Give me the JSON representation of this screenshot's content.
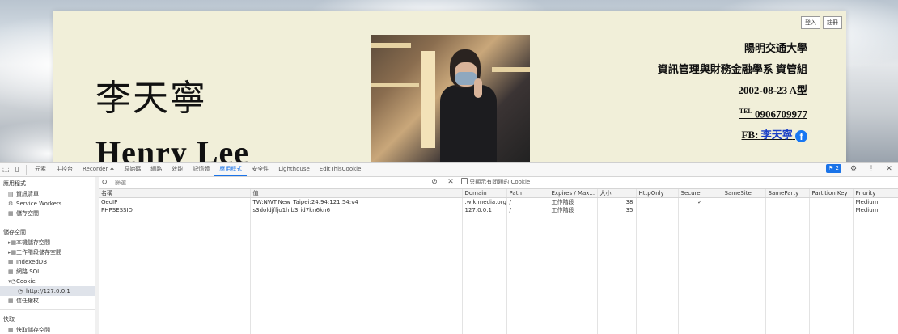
{
  "webpage": {
    "auth": {
      "login": "登入",
      "register": "註冊"
    },
    "name_cn": "李天寧",
    "name_en": "Henry Lee",
    "info": {
      "school": "陽明交通大學",
      "department": "資訊管理與財務金融學系 資管組",
      "birth": "2002-08-23 A型",
      "tel_prefix": "TEL",
      "tel": "0906709977",
      "fb_prefix": "FB:",
      "fb_name": "李天寧",
      "fb_icon": "f"
    }
  },
  "devtools": {
    "tabs": [
      "元素",
      "主控台",
      "Recorder ⏶",
      "原始碼",
      "網路",
      "效能",
      "記憶體",
      "應用程式",
      "安全性",
      "Lighthouse",
      "EditThisCookie"
    ],
    "active_tab": "應用程式",
    "issues_count": "2",
    "sidebar": {
      "app_section": "應用程式",
      "app_items": [
        "資訊清單",
        "Service Workers",
        "儲存空間"
      ],
      "storage_section": "儲存空間",
      "storage_items": [
        "本機儲存空間",
        "工作階段儲存空間",
        "IndexedDB",
        "網路 SQL",
        "Cookie"
      ],
      "cookie_origin": "http://127.0.0.1",
      "trust_tokens": "信任權杖",
      "cache_section": "快取",
      "cache_item": "快取儲存空間"
    },
    "filter": {
      "placeholder": "篩選",
      "only_issues_label": "只顯示有問題的 Cookie"
    },
    "table": {
      "headers": [
        "名稱",
        "值",
        "Domain",
        "Path",
        "Expires / Max...",
        "大小",
        "HttpOnly",
        "Secure",
        "SameSite",
        "SameParty",
        "Partition Key",
        "Priority"
      ],
      "rows": [
        [
          "GeoIP",
          "TW:NWT:New_Taipei:24.94:121.54:v4",
          ".wikimedia.org",
          "/",
          "工作階段",
          "38",
          "",
          "✓",
          "",
          "",
          "",
          "Medium"
        ],
        [
          "PHPSESSID",
          "s3doldjffjo1hlb3rid7kn6kn6",
          "127.0.0.1",
          "/",
          "工作階段",
          "35",
          "",
          "",
          "",
          "",
          "",
          "Medium"
        ]
      ]
    }
  }
}
